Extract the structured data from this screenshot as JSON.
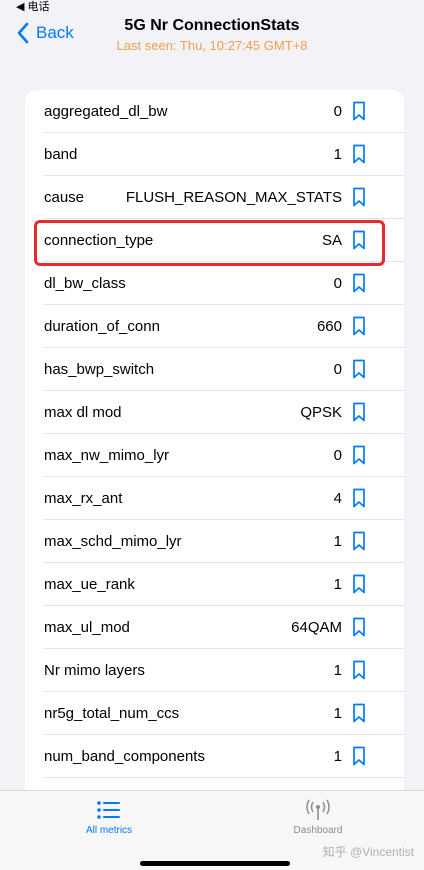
{
  "status_bar": {
    "back_app": "◀ 电话"
  },
  "nav": {
    "back_label": "Back",
    "title": "5G Nr ConnectionStats",
    "subtitle": "Last seen: Thu, 10:27:45 GMT+8"
  },
  "metrics": [
    {
      "label": "aggregated_dl_bw",
      "value": "0"
    },
    {
      "label": "band",
      "value": "1"
    },
    {
      "label": "cause",
      "value": "FLUSH_REASON_MAX_STATS"
    },
    {
      "label": "connection_type",
      "value": "SA"
    },
    {
      "label": "dl_bw_class",
      "value": "0"
    },
    {
      "label": "duration_of_conn",
      "value": "660"
    },
    {
      "label": "has_bwp_switch",
      "value": "0"
    },
    {
      "label": "max dl mod",
      "value": "QPSK"
    },
    {
      "label": "max_nw_mimo_lyr",
      "value": "0"
    },
    {
      "label": "max_rx_ant",
      "value": "4"
    },
    {
      "label": "max_schd_mimo_lyr",
      "value": "1"
    },
    {
      "label": "max_ue_rank",
      "value": "1"
    },
    {
      "label": "max_ul_mod",
      "value": "64QAM"
    },
    {
      "label": "Nr mimo layers",
      "value": "1"
    },
    {
      "label": "nr5g_total_num_ccs",
      "value": "1"
    },
    {
      "label": "num_band_components",
      "value": "1"
    }
  ],
  "tabbar": {
    "all_metrics": "All metrics",
    "dashboard": "Dashboard",
    "watermark": "知乎 @Vincentist"
  },
  "colors": {
    "accent": "#007aff",
    "subtitle": "#f0a04b",
    "highlight": "#e8292d"
  }
}
